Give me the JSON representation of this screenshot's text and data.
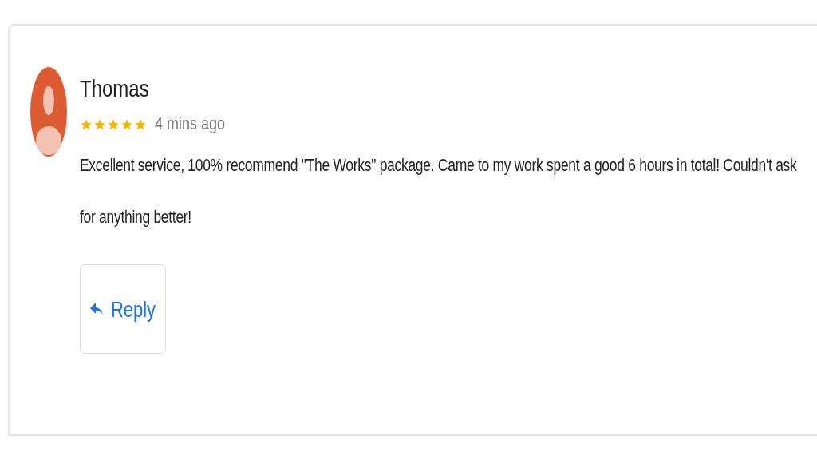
{
  "review": {
    "author": "Thomas",
    "stars": 5,
    "time": "4 mins ago",
    "text": "Excellent service, 100% recommend \"The Works\" package. Came to my work spent a good 6 hours in total! Couldn't ask for anything better!",
    "reply_button": "Reply"
  }
}
